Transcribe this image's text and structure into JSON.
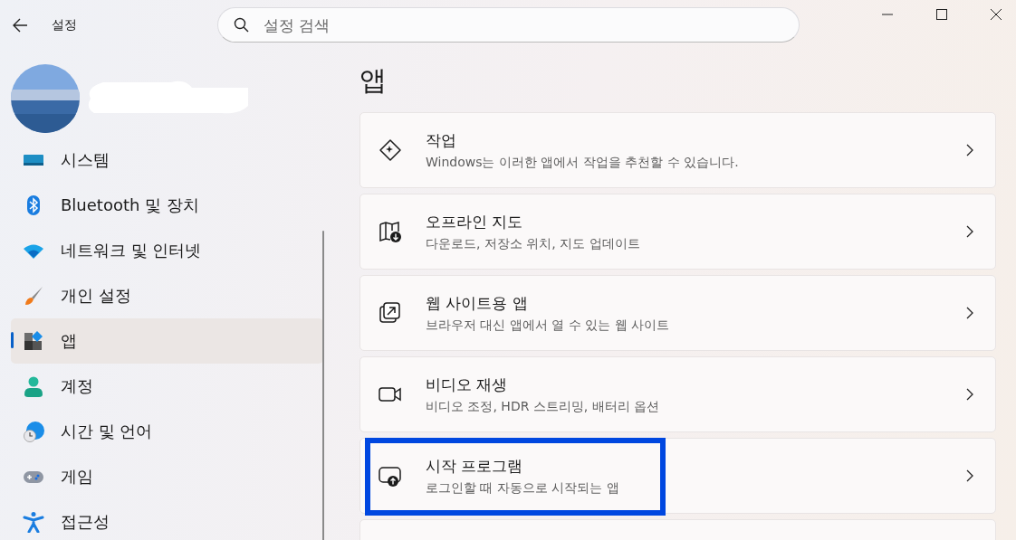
{
  "window": {
    "title": "설정"
  },
  "search": {
    "placeholder": "설정 검색"
  },
  "sidebar": {
    "items": [
      {
        "label": "시스템",
        "selected": false
      },
      {
        "label": "Bluetooth 및 장치",
        "selected": false
      },
      {
        "label": "네트워크 및 인터넷",
        "selected": false
      },
      {
        "label": "개인 설정",
        "selected": false
      },
      {
        "label": "앱",
        "selected": true
      },
      {
        "label": "계정",
        "selected": false
      },
      {
        "label": "시간 및 언어",
        "selected": false
      },
      {
        "label": "게임",
        "selected": false
      },
      {
        "label": "접근성",
        "selected": false
      }
    ]
  },
  "page": {
    "title": "앱",
    "cards": [
      {
        "title": "작업",
        "subtitle": "Windows는 이러한 앱에서 작업을 추천할 수 있습니다.",
        "highlighted": false
      },
      {
        "title": "오프라인 지도",
        "subtitle": "다운로드, 저장소 위치, 지도 업데이트",
        "highlighted": false
      },
      {
        "title": "웹 사이트용 앱",
        "subtitle": "브라우저 대신 앱에서 열 수 있는 웹 사이트",
        "highlighted": false
      },
      {
        "title": "비디오 재생",
        "subtitle": "비디오 조정, HDR 스트리밍, 배터리 옵션",
        "highlighted": false
      },
      {
        "title": "시작 프로그램",
        "subtitle": "로그인할 때 자동으로 시작되는 앱",
        "highlighted": true
      }
    ]
  }
}
